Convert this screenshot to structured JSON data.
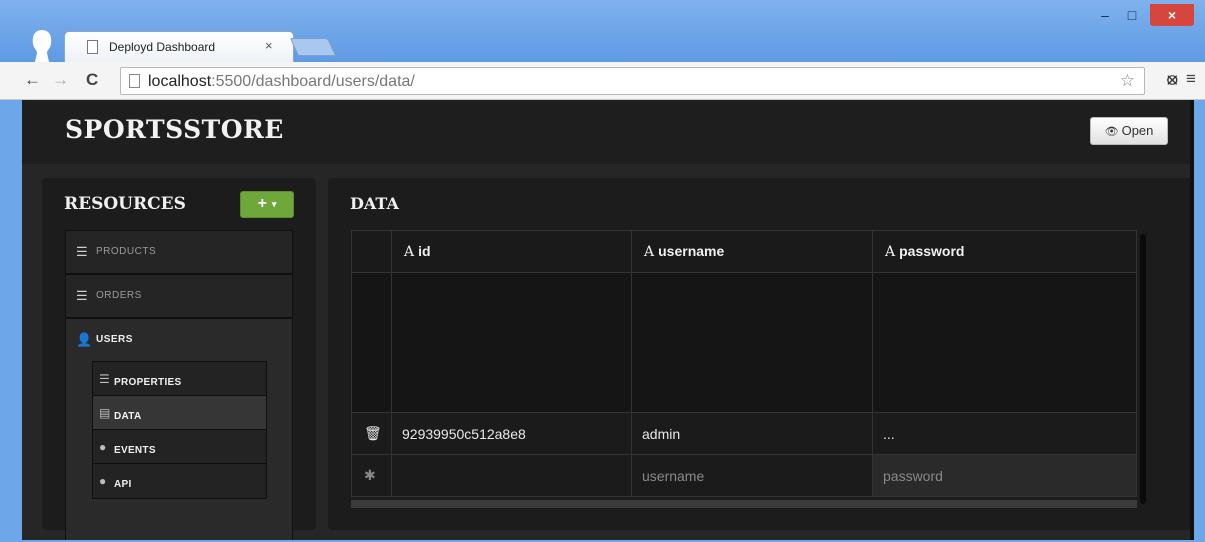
{
  "browser": {
    "tab_title": "Deployd Dashboard",
    "tab_close": "×",
    "url_host": "localhost",
    "url_rest": ":5500/dashboard/users/data/",
    "back": "←",
    "forward": "→",
    "reload": "C",
    "star": "☆",
    "ext": "⦻",
    "menu": "≡",
    "win_min": "–",
    "win_max": "□",
    "win_close": "×"
  },
  "app": {
    "brand": "SPORTSSTORE",
    "open_label": "Open"
  },
  "sidebar": {
    "title": "RESOURCES",
    "add_label": "+",
    "resources": [
      {
        "label": "PRODUCTS",
        "icon": "list-icon"
      },
      {
        "label": "ORDERS",
        "icon": "list-icon"
      },
      {
        "label": "USERS",
        "icon": "user-icon"
      }
    ],
    "users_sub": [
      {
        "label": "PROPERTIES",
        "icon": "list-icon"
      },
      {
        "label": "DATA",
        "icon": "table-icon"
      },
      {
        "label": "EVENTS",
        "icon": "exclamation-icon"
      },
      {
        "label": "API",
        "icon": "info-icon"
      }
    ]
  },
  "main": {
    "title": "DATA",
    "columns": [
      {
        "type": "A",
        "name": "id"
      },
      {
        "type": "A",
        "name": "username"
      },
      {
        "type": "A",
        "name": "password"
      }
    ],
    "rows": [
      {
        "id": "92939950c512a8e8",
        "username": "admin",
        "password": "..."
      }
    ],
    "new_row": {
      "username_placeholder": "username",
      "password_placeholder": "password"
    }
  }
}
